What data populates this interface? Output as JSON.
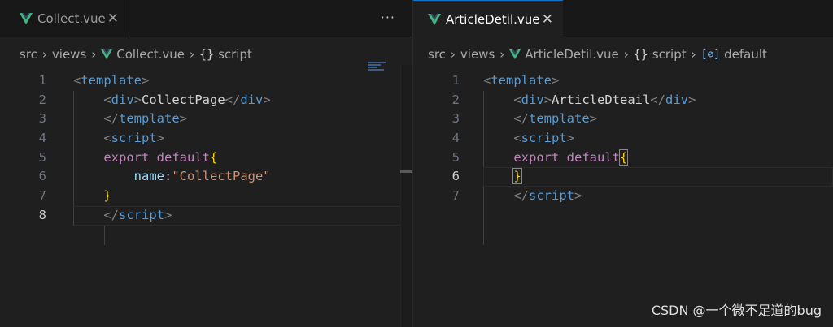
{
  "left": {
    "tab": {
      "label": "Collect.vue",
      "close": "✕"
    },
    "more": "···",
    "breadcrumb": {
      "src": "src",
      "views": "views",
      "file": "Collect.vue",
      "braces": "{}",
      "section": "script"
    },
    "line_numbers": [
      "1",
      "2",
      "3",
      "4",
      "5",
      "6",
      "7",
      "8"
    ]
  },
  "right": {
    "tab": {
      "label": "ArticleDetil.vue",
      "close": "✕"
    },
    "breadcrumb": {
      "src": "src",
      "views": "views",
      "file": "ArticleDetil.vue",
      "braces": "{}",
      "section": "script",
      "field_icon": "[⊘]",
      "member": "default"
    },
    "line_numbers": [
      "1",
      "2",
      "3",
      "4",
      "5",
      "6",
      "7"
    ]
  },
  "code": {
    "lt": "<",
    "gt": ">",
    "lts": "</",
    "template": "template",
    "div": "div",
    "script": "script",
    "left_div_text": "CollectPage",
    "right_div_text": "ArticleDteail",
    "export": "export",
    "default": "default",
    "open_brace": "{",
    "close_brace": "}",
    "name_key": "name",
    "colon": ":",
    "name_val": "\"CollectPage\""
  },
  "icons": {
    "vue": "vue-icon",
    "chevron": "chevron-right-icon",
    "braces": "braces-icon",
    "field": "field-icon"
  },
  "watermark": "CSDN @一个微不足道的bug",
  "colors": {
    "accent": "#0078d4",
    "vue": "#41b883",
    "tag": "#569cd6",
    "keyword": "#c586c0",
    "string": "#ce9178",
    "brace": "#ffd700"
  }
}
